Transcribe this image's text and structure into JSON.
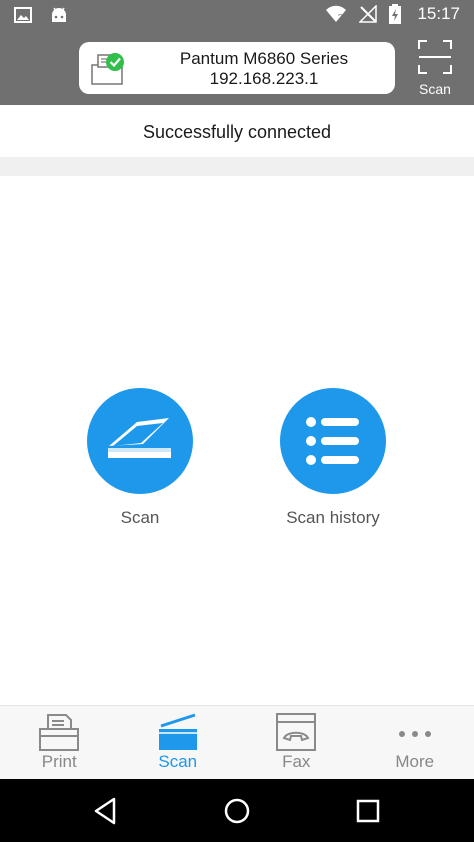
{
  "status_bar": {
    "time": "15:17",
    "icons": [
      "image-icon",
      "android-icon",
      "wifi-icon",
      "no-signal-icon",
      "battery-charging-icon"
    ]
  },
  "header": {
    "printer_name": "Pantum M6860 Series",
    "printer_ip": "192.168.223.1",
    "scan_label": "Scan"
  },
  "connection": {
    "message": "Successfully connected"
  },
  "actions": [
    {
      "label": "Scan",
      "icon": "scanner-icon"
    },
    {
      "label": "Scan history",
      "icon": "list-icon"
    }
  ],
  "bottom_nav": {
    "items": [
      {
        "label": "Print",
        "icon": "printer-icon",
        "active": false
      },
      {
        "label": "Scan",
        "icon": "scanner-icon",
        "active": true
      },
      {
        "label": "Fax",
        "icon": "fax-icon",
        "active": false
      },
      {
        "label": "More",
        "icon": "more-dots-icon",
        "active": false
      }
    ]
  },
  "colors": {
    "accent": "#1e98eb",
    "header_bg": "#707070",
    "success": "#2fbf4a"
  }
}
